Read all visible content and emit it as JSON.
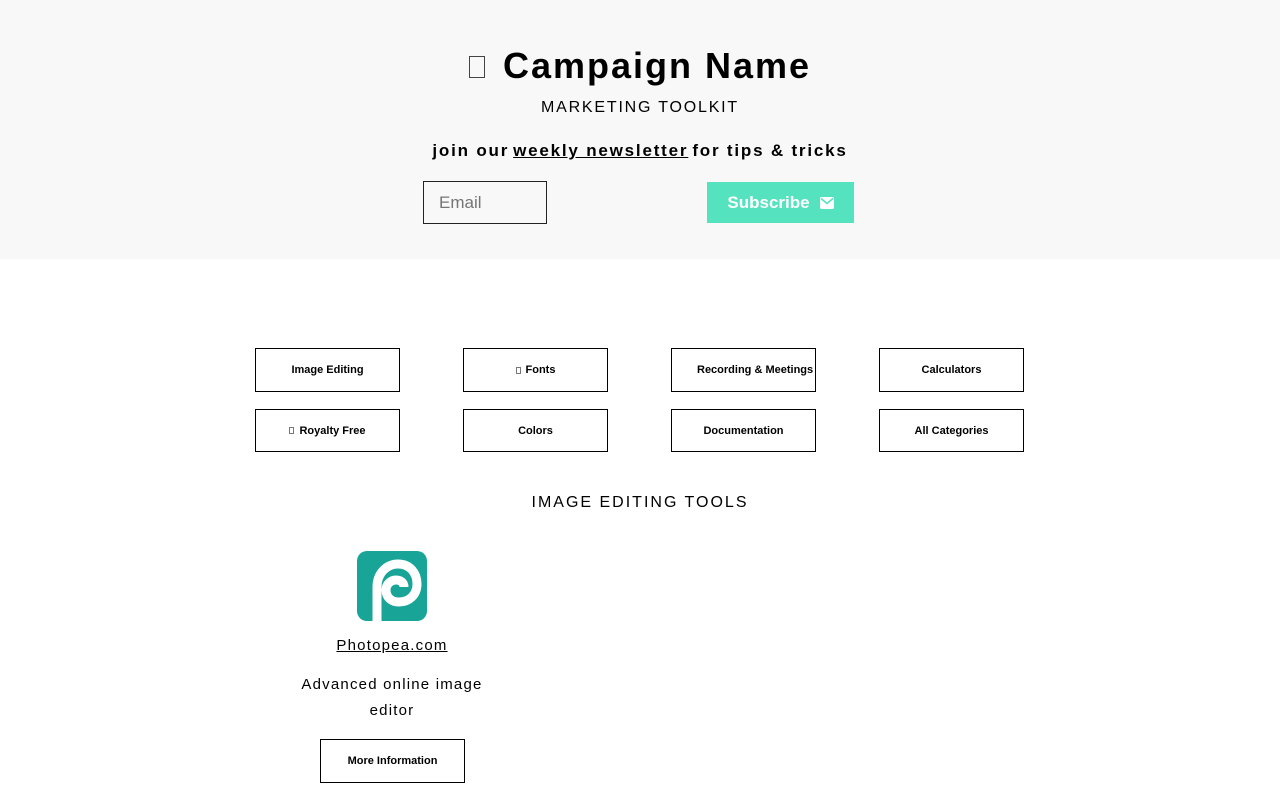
{
  "header": {
    "title": "Campaign Name",
    "subtitle": "MARKETING TOOLKIT",
    "newsletter_prefix": "join our",
    "newsletter_link": "weekly newsletter",
    "newsletter_suffix": "for tips & tricks",
    "email_placeholder": "Email",
    "email_value": "",
    "subscribe_label": "Subscribe",
    "subscribe_color": "#55e3bf",
    "background_color": "#f8f8f8"
  },
  "categories": [
    {
      "label": "Image Editing",
      "icon": "none"
    },
    {
      "label": "Fonts",
      "icon": "box-icon"
    },
    {
      "label": "Recording & Meetings",
      "icon": "none"
    },
    {
      "label": "Calculators",
      "icon": "none"
    },
    {
      "label": "Royalty Free",
      "icon": "box-icon"
    },
    {
      "label": "Colors",
      "icon": "none"
    },
    {
      "label": "Documentation",
      "icon": "none"
    },
    {
      "label": "All Categories",
      "icon": "none"
    }
  ],
  "section": {
    "heading": "IMAGE EDITING TOOLS"
  },
  "tools": [
    {
      "name": "Photopea.com",
      "description": "Advanced online image editor",
      "more_label": "More Information",
      "logo_color": "#18a497",
      "logo_icon": "photopea-logo-icon"
    }
  ]
}
